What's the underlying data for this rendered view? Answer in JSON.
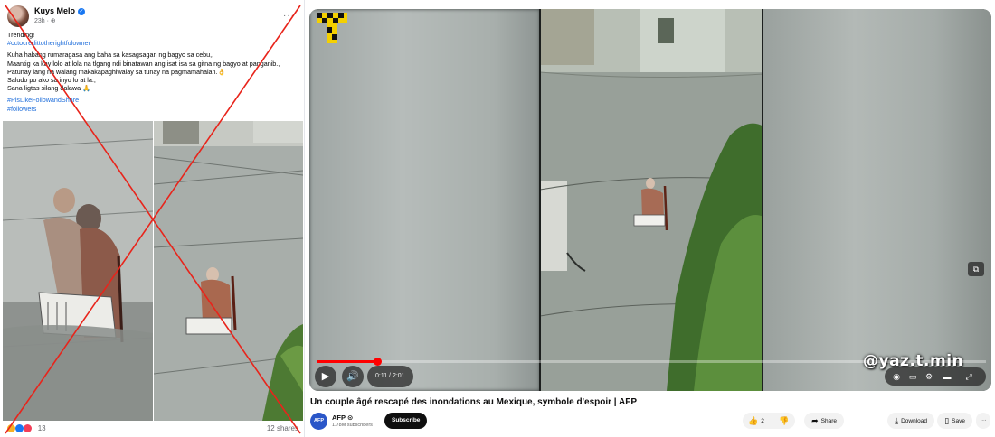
{
  "facebook_post": {
    "author": "Kuys Melo",
    "time": "23h · ",
    "more_label": "···",
    "lines": [
      "Trending!",
      "#cctocredittotherightfulowner",
      "",
      "Kuha habang rumaragasa ang baha sa kasagsagan ng bagyo sa cebu,,",
      "Maantig ka kay lolo at lola na tlgang ndi binatawan ang isat isa sa gitna ng bagyo at panganib.,",
      "Patunay lang na walang makakapaghiwalay sa tunay na pagmamahalan.👌",
      "Saludo po ako sa inyo lo at la.,",
      "Sana ligtas silang dalawa 🙏",
      "",
      "#PlsLikeFollowandShare",
      "#followers"
    ],
    "reaction_count": "13",
    "shares": "12 shares",
    "crossed_out": true
  },
  "youtube": {
    "watermark": "@yaz.t.min",
    "time_display": "0:11 / 2:01",
    "progress": 0.0912,
    "title": "Un couple âgé rescapé des inondations au Mexique, symbole d'espoir | AFP",
    "channel": {
      "avatar_text": "AFP",
      "name": "AFP",
      "subscribers": "1.78M subscribers",
      "subscribe_label": "Subscribe"
    },
    "like_count": "2",
    "share_label": "Share",
    "download_label": "Download",
    "save_label": "Save",
    "more_label": "···"
  },
  "colors": {
    "fb_link": "#216fdb",
    "cross": "#e8241b",
    "yt_red": "#ff0000",
    "subscribe_bg": "#0f0f0f"
  }
}
